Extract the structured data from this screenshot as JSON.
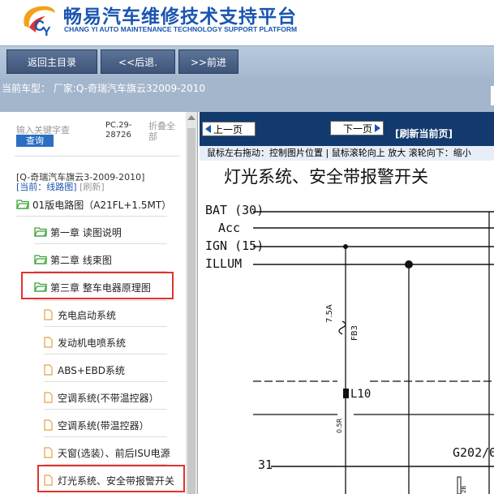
{
  "header": {
    "title_cn": "畅易汽车维修技术支持平台",
    "title_en": "CHANG YI AUTO MAINTENANCE TECHNOLOGY SUPPORT PLATFORM"
  },
  "toolbar": {
    "home_label": "返回主目录",
    "back_label": "<<后退.",
    "forward_label": ">>前进"
  },
  "carline": {
    "text": "当前车型： 厂家:Q-奇瑞汽车旗云32009-2010"
  },
  "sidebar": {
    "search_placeholder": "输入关键字查",
    "query_label": "查询",
    "pc_code": "PC.29-28726",
    "collapse_label": "折叠全部",
    "breadcrumb": "[Q-奇瑞汽车旗云3-2009-2010]",
    "current_prefix": "[当前：线路图]",
    "refresh_label": "[刷新]",
    "root": "01版电路图（A21FL+1.5MT）",
    "chapters": [
      {
        "label": "第一章 读图说明"
      },
      {
        "label": "第二章 线束图"
      },
      {
        "label": "第三章 整车电器原理图"
      }
    ],
    "systems": [
      {
        "label": "充电启动系统"
      },
      {
        "label": "发动机电喷系统"
      },
      {
        "label": "ABS+EBD系统"
      },
      {
        "label": "空调系统(不带温控器）"
      },
      {
        "label": "空调系统(带温控器）"
      },
      {
        "label": "天窗(选装）、前后ISU电源"
      },
      {
        "label": "灯光系统、安全带报警开关"
      }
    ]
  },
  "viewer": {
    "prev_label": "上一页",
    "next_label": "下一页",
    "refresh_label": "[刷新当前页]",
    "hint": "鼠标左右拖动：控制图片位置 | 鼠标滚轮向上 放大  滚轮向下：缩小",
    "diagram_title": "灯光系统、安全带报警开关",
    "bus_labels": [
      "BAT (30)",
      "Acc",
      "IGN (15)",
      "ILLUM"
    ],
    "fuse_label": "7.5A",
    "fuse_code": "FB3",
    "connector_label": "L10",
    "wire_code": "0.5R",
    "ground_label": "G202/0",
    "pin_label": "31",
    "small_code": "2B"
  },
  "colors": {
    "brand_blue": "#1a55b0",
    "highlight_red": "#e0332d",
    "toolbar_bg": "#a4b6cc",
    "viewer_nav_bg": "#123a6e",
    "folder_green": "#3aa33a",
    "doc_orange": "#e6a040"
  }
}
